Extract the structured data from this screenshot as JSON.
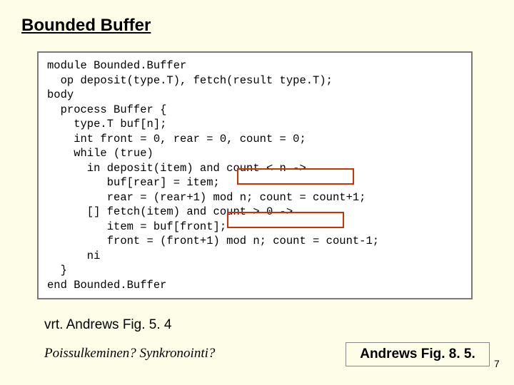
{
  "title": "Bounded Buffer",
  "code": "module Bounded.Buffer\n  op deposit(type.T), fetch(result type.T);\nbody\n  process Buffer {\n    type.T buf[n];\n    int front = 0, rear = 0, count = 0;\n    while (true)\n      in deposit(item) and count < n ->\n         buf[rear] = item;\n         rear = (rear+1) mod n; count = count+1;\n      [] fetch(item) and count > 0 ->\n         item = buf[front];\n         front = (front+1) mod n; count = count-1;\n      ni\n  }\nend Bounded.Buffer",
  "highlight1_text": "and count < n",
  "highlight2_text": "and count > 0",
  "caption1": "vrt. Andrews Fig. 5. 4",
  "caption2": "Poissulkeminen? Synkronointi?",
  "figlabel": "Andrews Fig. 8. 5.",
  "pagenum": "7"
}
